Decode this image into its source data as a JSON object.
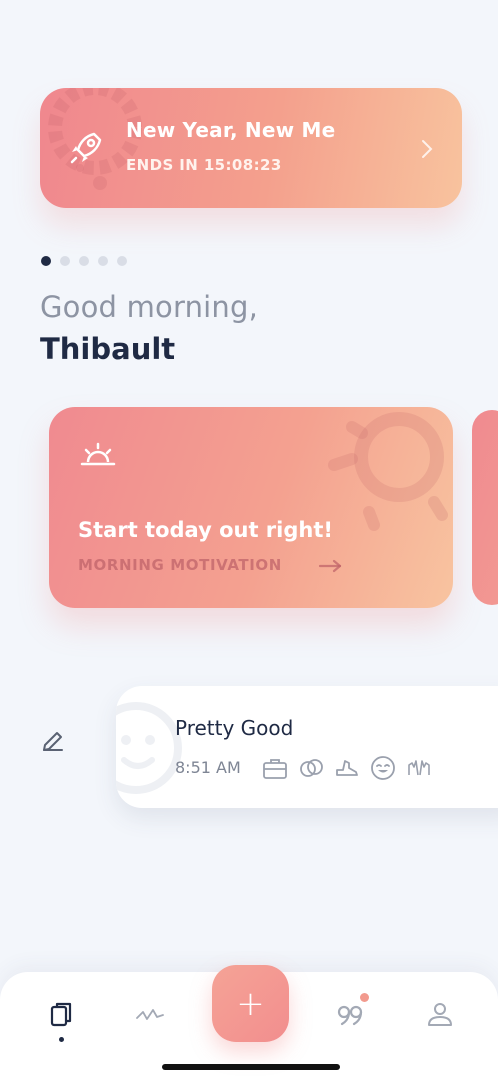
{
  "promo": {
    "title": "New Year, New Me",
    "subtitle": "ENDS IN 15:08:23"
  },
  "carousel": {
    "count": 5,
    "active": 0
  },
  "greeting": {
    "line1": "Good morning,",
    "name": "Thibault"
  },
  "motivation_card": {
    "title": "Start today out right!",
    "subtitle": "MORNING MOTIVATION",
    "arrow": "→"
  },
  "entry": {
    "mood": "Pretty Good",
    "time": "8:51 AM",
    "activity_icons": [
      "briefcase-icon",
      "rings-icon",
      "sneaker-icon",
      "blissful-face-icon",
      "hands-raised-icon"
    ]
  },
  "tabbar": {
    "tabs": [
      "entries-tab",
      "stats-tab",
      "add-button",
      "quotes-tab",
      "profile-tab"
    ],
    "add_label": "+",
    "accent": "#f29a8e"
  },
  "colors": {
    "background": "#f3f6fb",
    "accent_gradient_start": "#f0878e",
    "accent_gradient_end": "#f8c39e",
    "text_dark": "#1f2a44",
    "text_muted": "#8d94a3"
  }
}
